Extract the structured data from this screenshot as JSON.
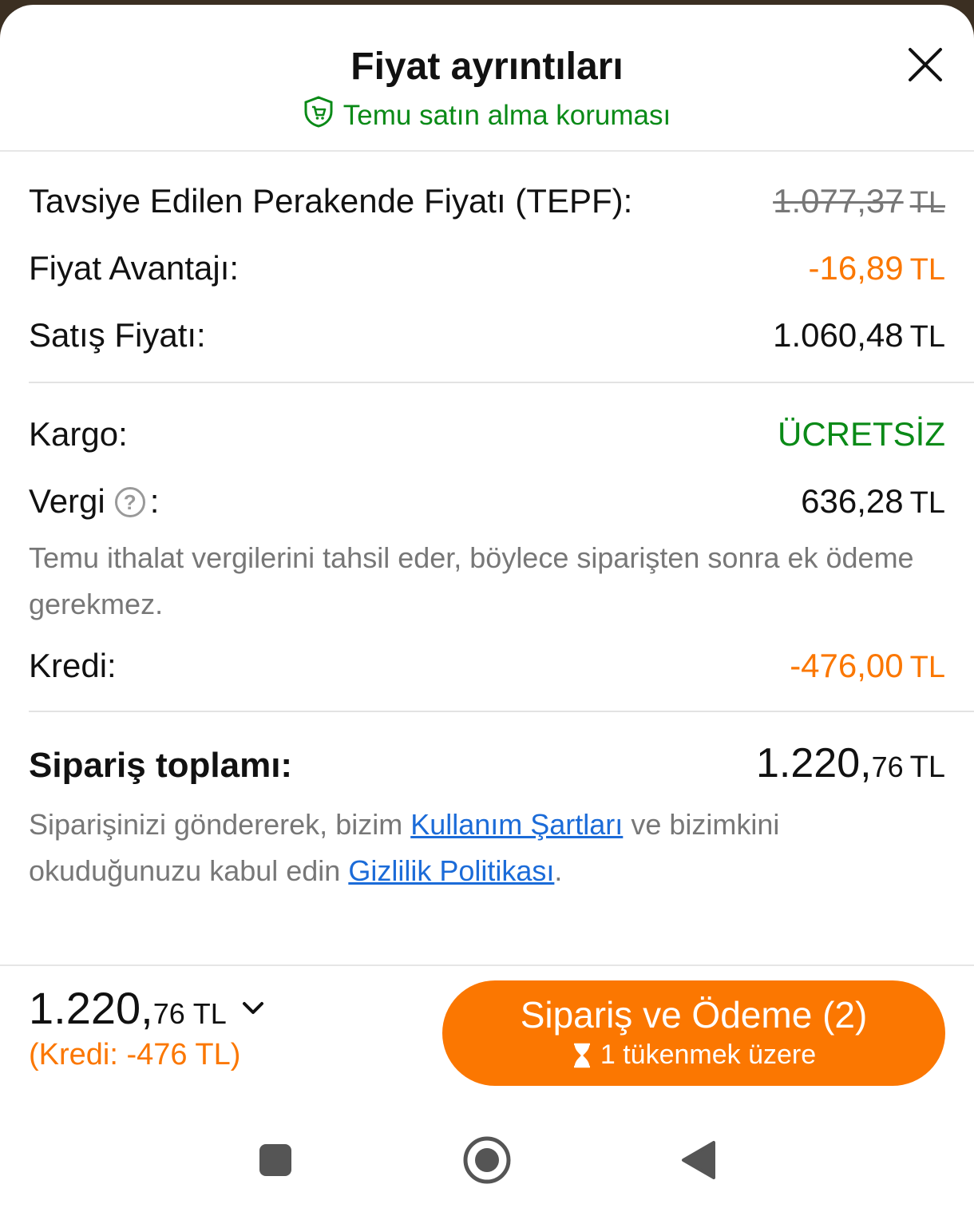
{
  "sheet": {
    "title": "Fiyat ayrıntıları",
    "protection": "Temu satın alma koruması"
  },
  "prices": {
    "msrp_label": "Tavsiye Edilen Perakende Fiyatı (TEPF):",
    "msrp_value": "1.077,37",
    "advantage_label": "Fiyat Avantajı:",
    "advantage_value": "-16,89",
    "sale_label": "Satış Fiyatı:",
    "sale_value": "1.060,48",
    "currency": "TL"
  },
  "charges": {
    "shipping_label": "Kargo:",
    "shipping_value": "ÜCRETSİZ",
    "tax_label": "Vergi",
    "tax_colon": ":",
    "tax_value": "636,28",
    "tax_note": "Temu ithalat vergilerini tahsil eder, böylece siparişten sonra ek ödeme gerekmez.",
    "credit_label": "Kredi:",
    "credit_value": "-476,00"
  },
  "total": {
    "label": "Sipariş toplamı:",
    "int_part": "1.220,",
    "dec_part": "76",
    "terms_prefix": "Siparişinizi göndererek, bizim ",
    "terms_link": "Kullanım Şartları",
    "terms_mid": " ve bizimkini okuduğunuzu kabul edin ",
    "privacy_link": "Gizlilik Politikası",
    "terms_suffix": "."
  },
  "footer": {
    "total_int": "1.220,",
    "total_dec": "76",
    "currency": "TL",
    "credit_note": "(Kredi: -476 TL)",
    "cta_label": "Sipariş ve Ödeme (2)",
    "cta_sub": "1 tükenmek üzere"
  },
  "colors": {
    "accent_orange": "#fb7701",
    "green": "#0a8a17",
    "link_blue": "#1b6bd8"
  },
  "icons": {
    "close": "close-icon",
    "shield": "shield-cart-icon",
    "help": "help-circle-icon",
    "chevron": "chevron-down-icon",
    "hourglass": "hourglass-icon",
    "nav_recent": "square-icon",
    "nav_home": "circle-icon",
    "nav_back": "triangle-back-icon"
  }
}
